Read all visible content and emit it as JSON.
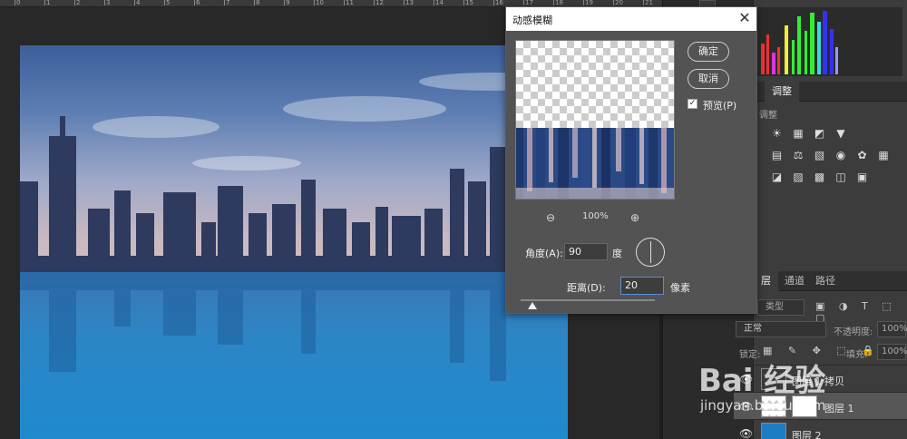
{
  "ruler": {
    "numbers": [
      "0",
      "1",
      "2",
      "3",
      "4",
      "5",
      "6",
      "7",
      "8",
      "9",
      "10",
      "11",
      "12",
      "13",
      "14",
      "15",
      "16",
      "17",
      "18",
      "19",
      "20",
      "21"
    ]
  },
  "dialog": {
    "title": "动感模糊",
    "close_glyph": "✕",
    "ok_label": "确定",
    "cancel_label": "取消",
    "preview_label": "预览(P)",
    "preview_checked": true,
    "zoom_out_glyph": "⊖",
    "zoom_level": "100%",
    "zoom_in_glyph": "⊕",
    "angle_label": "角度(A):",
    "angle_value": "90",
    "angle_unit": "度",
    "distance_label": "距离(D):",
    "distance_value": "20",
    "distance_unit": "像素"
  },
  "adjustments": {
    "tabs": [
      "",
      "调整"
    ],
    "section_title": "调整",
    "row1_icons": [
      "☀",
      "▦",
      "◩",
      "▼"
    ],
    "row2_icons": [
      "▤",
      "⚖",
      "▧",
      "◉",
      "✿",
      "▦"
    ],
    "row3_icons": [
      "◪",
      "▨",
      "▩",
      "◫",
      "▣"
    ]
  },
  "layers": {
    "tabs": [
      "层",
      "通道",
      "路径"
    ],
    "filter_label": "类型",
    "filter_icons": "▣ ◑ T ⬚ ▢",
    "blend_mode": "正常",
    "opacity_label": "不透明度:",
    "opacity_value": "100%",
    "lock_label": "锁定:",
    "lock_icons": "▦ ✎ ✥ ⬚ 🔒",
    "fill_label": "填充:",
    "fill_value": "100%",
    "items": [
      {
        "name": "图层 1 拷贝",
        "visible": true,
        "selected": false
      },
      {
        "name": "图层 1",
        "visible": true,
        "selected": true
      },
      {
        "name": "图层 2",
        "visible": true,
        "selected": false
      }
    ]
  },
  "watermark": {
    "logo": "Bai 经验",
    "url": "jingyan.baidu.com"
  },
  "colors": {
    "water": "#1e8ad0",
    "sky_top": "#3c5f9b",
    "dialog_bg": "#535353",
    "accent": "#5b8ed6"
  }
}
